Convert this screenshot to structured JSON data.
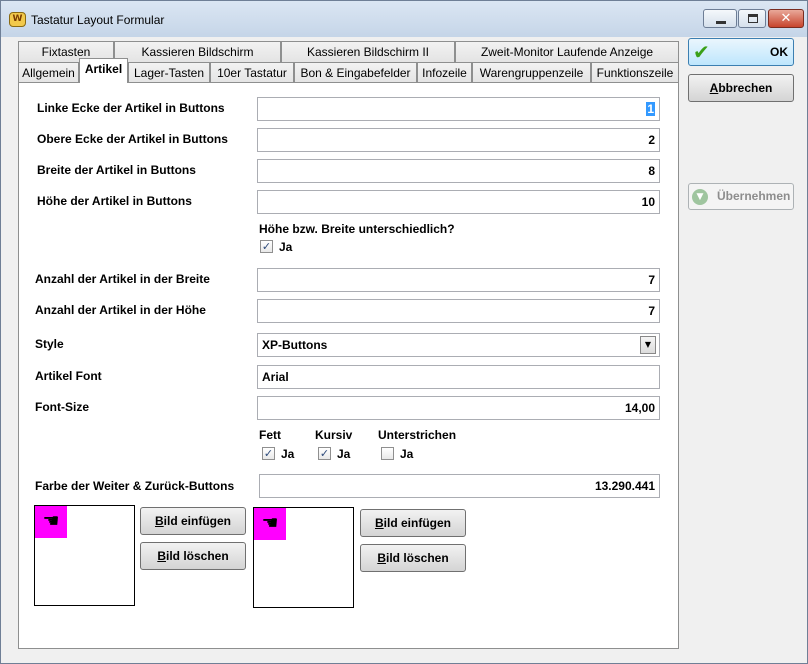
{
  "window": {
    "title": "Tastatur Layout Formular"
  },
  "tabs_row1": [
    "Fixtasten",
    "Kassieren Bildschirm",
    "Kassieren Bildschirm II",
    "Zweit-Monitor Laufende Anzeige"
  ],
  "tabs_row2": [
    "Allgemein",
    "Artikel",
    "Lager-Tasten",
    "10er Tastatur",
    "Bon & Eingabefelder",
    "Infozeile",
    "Warengruppenzeile",
    "Funktionszeile"
  ],
  "active_tab": "Artikel",
  "fields": {
    "linke_ecke": {
      "label": "Linke Ecke der Artikel in Buttons",
      "value": "1"
    },
    "obere_ecke": {
      "label": "Obere Ecke der Artikel in Buttons",
      "value": "2"
    },
    "breite": {
      "label": "Breite der Artikel in Buttons",
      "value": "8"
    },
    "hoehe": {
      "label": "Höhe der Artikel in Buttons",
      "value": "10"
    },
    "unterschiedlich": {
      "label": "Höhe bzw. Breite unterschiedlich?",
      "check_label": "Ja",
      "checked": true
    },
    "anzahl_breite": {
      "label": "Anzahl der Artikel in der Breite",
      "value": "7"
    },
    "anzahl_hoehe": {
      "label": "Anzahl der Artikel in der Höhe",
      "value": "7"
    },
    "style": {
      "label": "Style",
      "value": "XP-Buttons"
    },
    "font": {
      "label": "Artikel Font",
      "value": "Arial"
    },
    "font_size": {
      "label": "Font-Size",
      "value": "14,00"
    },
    "fett": {
      "label": "Fett",
      "check_label": "Ja",
      "checked": true
    },
    "kursiv": {
      "label": "Kursiv",
      "check_label": "Ja",
      "checked": true
    },
    "unterstrichen": {
      "label": "Unterstrichen",
      "check_label": "Ja",
      "checked": false
    },
    "farbe": {
      "label": "Farbe der Weiter & Zurück-Buttons",
      "value": "13.290.441"
    }
  },
  "image_buttons": {
    "insert_pre": "B",
    "insert_rest": "ild einfügen",
    "delete_pre": "B",
    "delete_rest": "ild löschen"
  },
  "side_buttons": {
    "ok": "OK",
    "cancel_pre": "A",
    "cancel_rest": "bbrechen",
    "apply": "Übernehmen"
  },
  "colors": {
    "image_bg": "#ff00ff",
    "ok_check": "#3aa018"
  }
}
